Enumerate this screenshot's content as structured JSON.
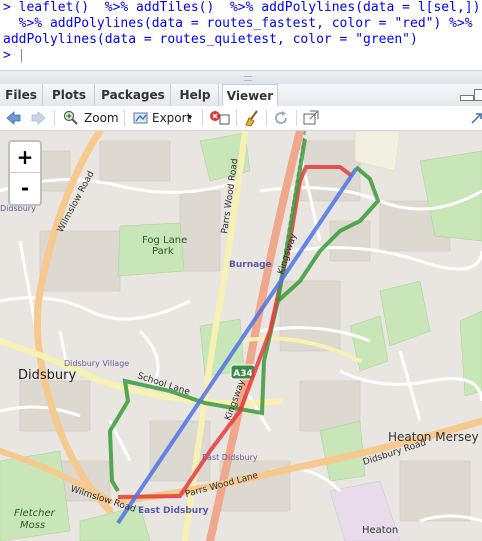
{
  "console": {
    "line1": "> leaflet()  %>% addTiles()  %>% addPolylines(data = l[sel,])",
    "line2": "  %>% addPolylines(data = routes_fastest, color = \"red\") %>%",
    "line3": "addPolylines(data = routes_quietest, color = \"green\")",
    "prompt": ">"
  },
  "tabs": [
    "Files",
    "Plots",
    "Packages",
    "Help",
    "Viewer"
  ],
  "active_tab": "Viewer",
  "toolbar": {
    "zoom_label": "Zoom",
    "export_label": "Export"
  },
  "map": {
    "zoom_in": "+",
    "zoom_out": "-",
    "places": {
      "didsbury_label": "Didsbury",
      "didsbury_small": "Didsbury",
      "didsbury_village": "Didsbury Village",
      "fog_lane_1": "Fog Lane",
      "fog_lane_2": "Park",
      "burnage": "Burnage",
      "heaton_mersey": "Heaton Mersey",
      "heaton": "Heaton",
      "east_didsbury": "East Didsbury",
      "east_didsbury_small": "East Didsbury",
      "fletcher_1": "Fletcher",
      "fletcher_2": "Moss"
    },
    "roads": {
      "wilmslow_road": "Wilmslow Road",
      "wilmslow_road_2": "Wilmslow Road",
      "parrs_wood_road": "Parrs Wood Road",
      "kingsway": "Kingsway",
      "kingsway_2": "Kingsway",
      "school_lane": "School Lane",
      "didsbury_road": "Didsbury Road",
      "parrs_wood_lane": "Parrs Wood Lane",
      "a34": "A34"
    },
    "route_colors": {
      "straight_line": "#4d73e6",
      "fastest": "#e8393a",
      "quietest": "#3a9a3a"
    }
  }
}
